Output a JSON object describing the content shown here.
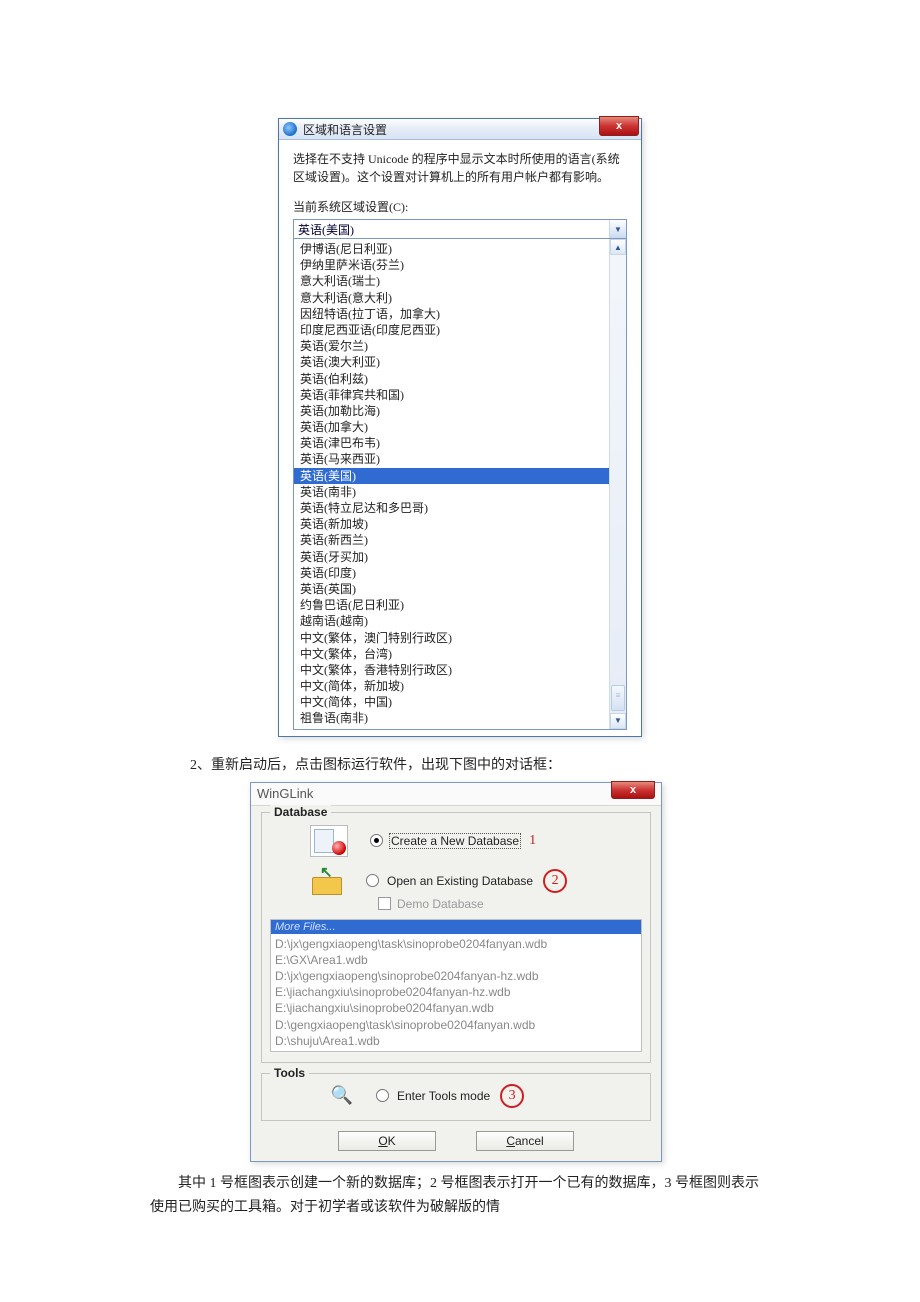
{
  "region_dialog": {
    "title": "区域和语言设置",
    "desc": "选择在不支持 Unicode 的程序中显示文本时所使用的语言(系统区域设置)。这个设置对计算机上的所有用户帐户都有影响。",
    "current_label": "当前系统区域设置(C):",
    "selected": "英语(美国)",
    "options": [
      "伊博语(尼日利亚)",
      "伊纳里萨米语(芬兰)",
      "意大利语(瑞士)",
      "意大利语(意大利)",
      "因纽特语(拉丁语，加拿大)",
      "印度尼西亚语(印度尼西亚)",
      "英语(爱尔兰)",
      "英语(澳大利亚)",
      "英语(伯利兹)",
      "英语(菲律宾共和国)",
      "英语(加勒比海)",
      "英语(加拿大)",
      "英语(津巴布韦)",
      "英语(马来西亚)",
      "英语(美国)",
      "英语(南非)",
      "英语(特立尼达和多巴哥)",
      "英语(新加坡)",
      "英语(新西兰)",
      "英语(牙买加)",
      "英语(印度)",
      "英语(英国)",
      "约鲁巴语(尼日利亚)",
      "越南语(越南)",
      "中文(繁体，澳门特别行政区)",
      "中文(繁体，台湾)",
      "中文(繁体，香港特别行政区)",
      "中文(简体，新加坡)",
      "中文(简体，中国)",
      "祖鲁语(南非)"
    ]
  },
  "paragraph2": "2、重新启动后，点击图标运行软件，出现下图中的对话框：",
  "wing": {
    "title": "WinGLink",
    "db_legend": "Database",
    "create_label": "Create a New Database",
    "open_label": "Open an Existing Database",
    "demo_label": "Demo Database",
    "more_header": "More Files...",
    "recent": [
      "D:\\jx\\gengxiaopeng\\task\\sinoprobe0204fanyan.wdb",
      "E:\\GX\\Area1.wdb",
      "D:\\jx\\gengxiaopeng\\sinoprobe0204fanyan-hz.wdb",
      "E:\\jiachangxiu\\sinoprobe0204fanyan-hz.wdb",
      "E:\\jiachangxiu\\sinoprobe0204fanyan.wdb",
      "D:\\gengxiaopeng\\task\\sinoprobe0204fanyan.wdb",
      "D:\\shuju\\Area1.wdb"
    ],
    "tools_legend": "Tools",
    "tools_label": "Enter Tools mode",
    "ok": "OK",
    "cancel": "Cancel",
    "call1": "1",
    "call2": "2",
    "call3": "3"
  },
  "paragraph3": "其中 1 号框图表示创建一个新的数据库；2 号框图表示打开一个已有的数据库，3 号框图则表示使用已购买的工具箱。对于初学者或该软件为破解版的情"
}
